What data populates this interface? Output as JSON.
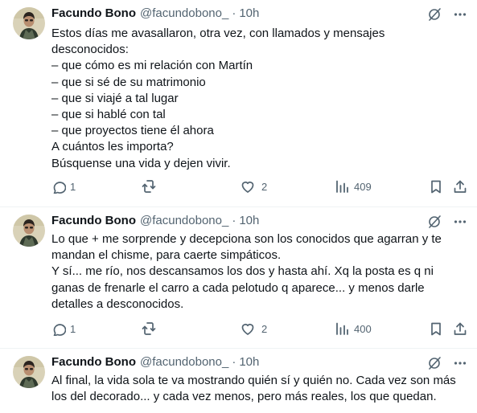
{
  "tweets": [
    {
      "author": {
        "name": "Facundo Bono",
        "handle": "@facundobono_",
        "time": "10h"
      },
      "text": "Estos días me avasallaron, otra vez, con llamados y mensajes\ndesconocidos:\n– que cómo es mi relación con Martín\n– que si sé de su matrimonio\n– que si viajé a tal lugar\n– que si hablé con tal\n– que proyectos tiene él ahora\nA cuántos les importa?\nBúsquense una vida y dejen vivir.",
      "replies": "1",
      "retweets": "",
      "likes": "2",
      "views": "409"
    },
    {
      "author": {
        "name": "Facundo Bono",
        "handle": "@facundobono_",
        "time": "10h"
      },
      "text": "Lo que + me sorprende y decepciona son los conocidos que agarran y te\nmandan el chisme, para caerte simpáticos.\nY sí... me río, nos descansamos los dos y hasta ahí. Xq la posta es q ni\nganas de frenarle el carro a cada pelotudo q aparece... y menos darle\ndetalles a desconocidos.",
      "replies": "1",
      "retweets": "",
      "likes": "2",
      "views": "400"
    },
    {
      "author": {
        "name": "Facundo Bono",
        "handle": "@facundobono_",
        "time": "10h"
      },
      "text": "Al final, la vida sola te va mostrando quién sí y quién no. Cada vez son más\nlos del decorado... y cada vez menos, pero más reales, los que quedan."
    }
  ],
  "separator": "·",
  "colors": {
    "text": "#0f1419",
    "secondary": "#536471",
    "divider": "#eff3f4"
  },
  "icons": [
    "grok-icon",
    "more-icon",
    "reply-icon",
    "retweet-icon",
    "like-icon",
    "views-icon",
    "bookmark-icon",
    "share-icon"
  ]
}
